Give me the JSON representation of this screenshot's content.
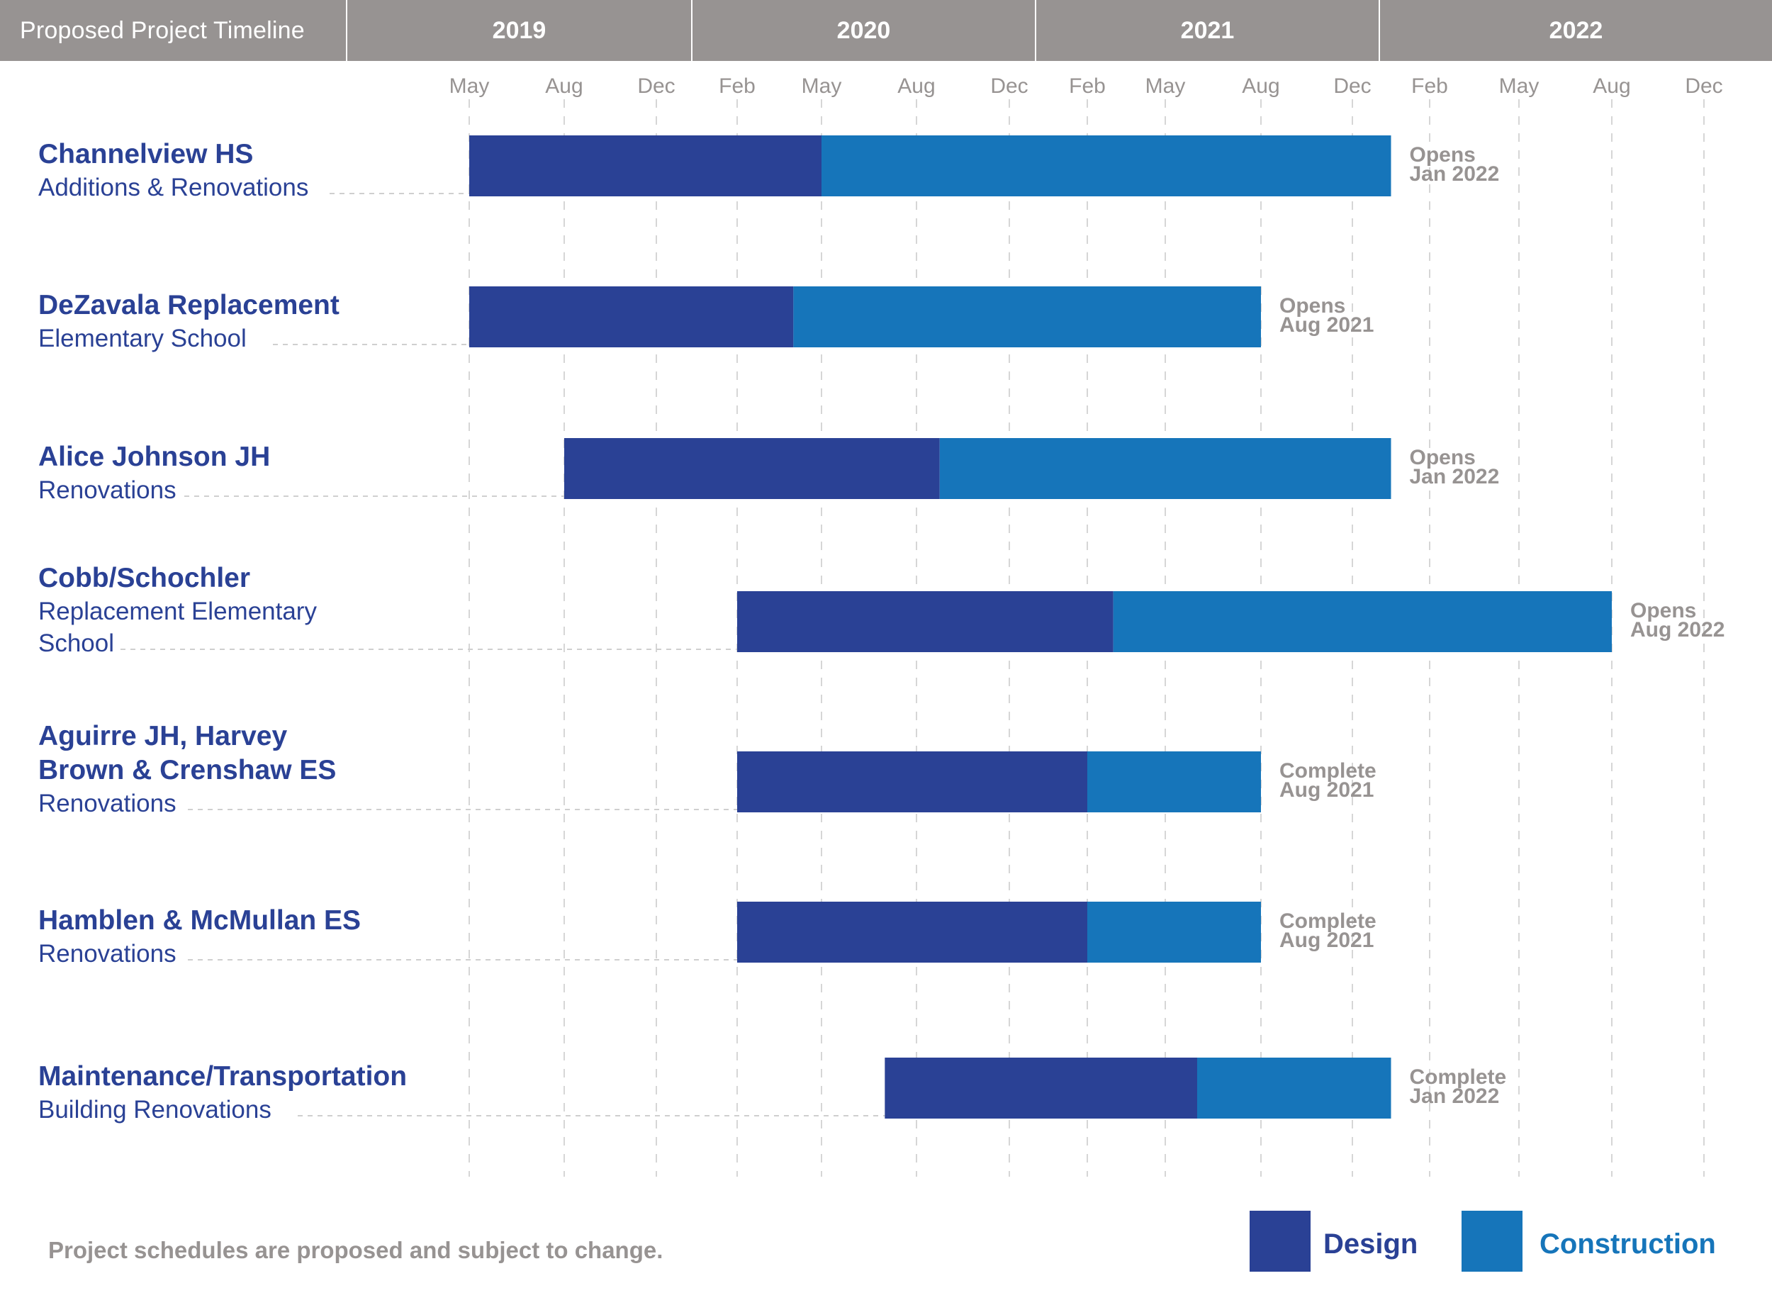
{
  "header": {
    "title": "Proposed Project Timeline",
    "years": [
      "2019",
      "2020",
      "2021",
      "2022"
    ]
  },
  "colors": {
    "design": "#2A4195",
    "construction": "#1675BA",
    "header_bg": "#979392",
    "label_gray": "#979392",
    "text_navy": "#2A4195"
  },
  "chart_data": {
    "type": "gantt",
    "title": "Proposed Project Timeline",
    "x_axis": {
      "unit": "month",
      "range": [
        "2019-05",
        "2022-12"
      ],
      "ticks": [
        {
          "label": "May",
          "date": "2019-05"
        },
        {
          "label": "Aug",
          "date": "2019-08"
        },
        {
          "label": "Dec",
          "date": "2019-12"
        },
        {
          "label": "Feb",
          "date": "2020-02"
        },
        {
          "label": "May",
          "date": "2020-05"
        },
        {
          "label": "Aug",
          "date": "2020-08"
        },
        {
          "label": "Dec",
          "date": "2020-12"
        },
        {
          "label": "Feb",
          "date": "2021-02"
        },
        {
          "label": "May",
          "date": "2021-05"
        },
        {
          "label": "Aug",
          "date": "2021-08"
        },
        {
          "label": "Dec",
          "date": "2021-12"
        },
        {
          "label": "Feb",
          "date": "2022-02"
        },
        {
          "label": "May",
          "date": "2022-05"
        },
        {
          "label": "Aug",
          "date": "2022-08"
        },
        {
          "label": "Dec",
          "date": "2022-12"
        }
      ],
      "grid": true
    },
    "legend": {
      "placement": "bottom-right",
      "entries": [
        {
          "name": "Design",
          "series": "design"
        },
        {
          "name": "Construction",
          "series": "construction"
        }
      ]
    },
    "rows": [
      {
        "title": [
          "Channelview HS"
        ],
        "subtitle": [
          "Additions & Renovations"
        ],
        "design_start": "2019-05",
        "design_end": "2020-05",
        "construction_end": "2022-01",
        "end_label": [
          "Opens",
          "Jan 2022"
        ]
      },
      {
        "title": [
          "DeZavala Replacement"
        ],
        "subtitle": [
          "Elementary School"
        ],
        "design_start": "2019-05",
        "design_end": "2020-04",
        "construction_end": "2021-08",
        "end_label": [
          "Opens",
          "Aug 2021"
        ]
      },
      {
        "title": [
          "Alice Johnson JH"
        ],
        "subtitle": [
          "Renovations"
        ],
        "design_start": "2019-08",
        "design_end": "2020-09",
        "construction_end": "2022-01",
        "end_label": [
          "Opens",
          "Jan 2022"
        ]
      },
      {
        "title": [
          "Cobb/Schochler"
        ],
        "subtitle": [
          "Replacement Elementary",
          "School"
        ],
        "design_start": "2020-02",
        "design_end": "2021-03",
        "construction_end": "2022-08",
        "end_label": [
          "Opens",
          "Aug 2022"
        ]
      },
      {
        "title": [
          "Aguirre JH, Harvey",
          "Brown & Crenshaw ES"
        ],
        "subtitle": [
          "Renovations"
        ],
        "design_start": "2020-02",
        "design_end": "2021-02",
        "construction_end": "2021-08",
        "end_label": [
          "Complete",
          "Aug 2021"
        ]
      },
      {
        "title": [
          "Hamblen & McMullan ES"
        ],
        "subtitle": [
          "Renovations"
        ],
        "design_start": "2020-02",
        "design_end": "2021-02",
        "construction_end": "2021-08",
        "end_label": [
          "Complete",
          "Aug 2021"
        ]
      },
      {
        "title": [
          "Maintenance/Transportation"
        ],
        "subtitle": [
          "Building Renovations"
        ],
        "design_start": "2020-07",
        "design_end": "2021-06",
        "construction_end": "2022-01",
        "end_label": [
          "Complete",
          "Jan 2022"
        ]
      }
    ]
  },
  "footnote": "Project schedules are proposed and subject to change."
}
